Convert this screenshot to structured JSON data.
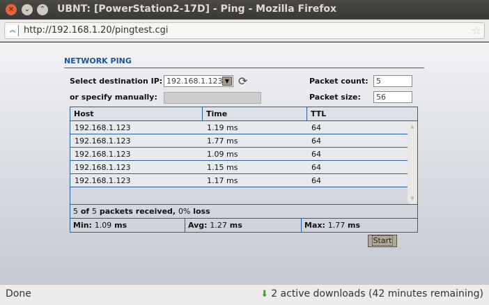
{
  "window": {
    "title": "UBNT: [PowerStation2-17D] - Ping - Mozilla Firefox"
  },
  "browser": {
    "url": "http://192.168.1.20/pingtest.cgi",
    "status": "Done",
    "downloads": "2 active downloads (42 minutes remaining)"
  },
  "page": {
    "section_title": "NETWORK PING",
    "dest_label": "Select destination IP:",
    "dest_value": "192.168.1.123",
    "manual_label": "or specify manually:",
    "manual_value": "",
    "count_label": "Packet count:",
    "count_value": "5",
    "size_label": "Packet size:",
    "size_value": "56",
    "columns": [
      "Host",
      "Time",
      "TTL"
    ],
    "rows": [
      {
        "host": "192.168.1.123",
        "time": "1.19 ms",
        "ttl": "64"
      },
      {
        "host": "192.168.1.123",
        "time": "1.77 ms",
        "ttl": "64"
      },
      {
        "host": "192.168.1.123",
        "time": "1.09 ms",
        "ttl": "64"
      },
      {
        "host": "192.168.1.123",
        "time": "1.15 ms",
        "ttl": "64"
      },
      {
        "host": "192.168.1.123",
        "time": "1.17 ms",
        "ttl": "64"
      }
    ],
    "summary": {
      "received": "5",
      "of": " of ",
      "total": "5",
      "text": " packets received, ",
      "loss": "0%",
      "loss_label": " loss"
    },
    "stats": {
      "min_label": "Min: ",
      "min": "1.09",
      "avg_label": "Avg: ",
      "avg": "1.27",
      "max_label": "Max: ",
      "max": "1.77",
      "unit": " ms"
    },
    "start_label": "Start"
  }
}
